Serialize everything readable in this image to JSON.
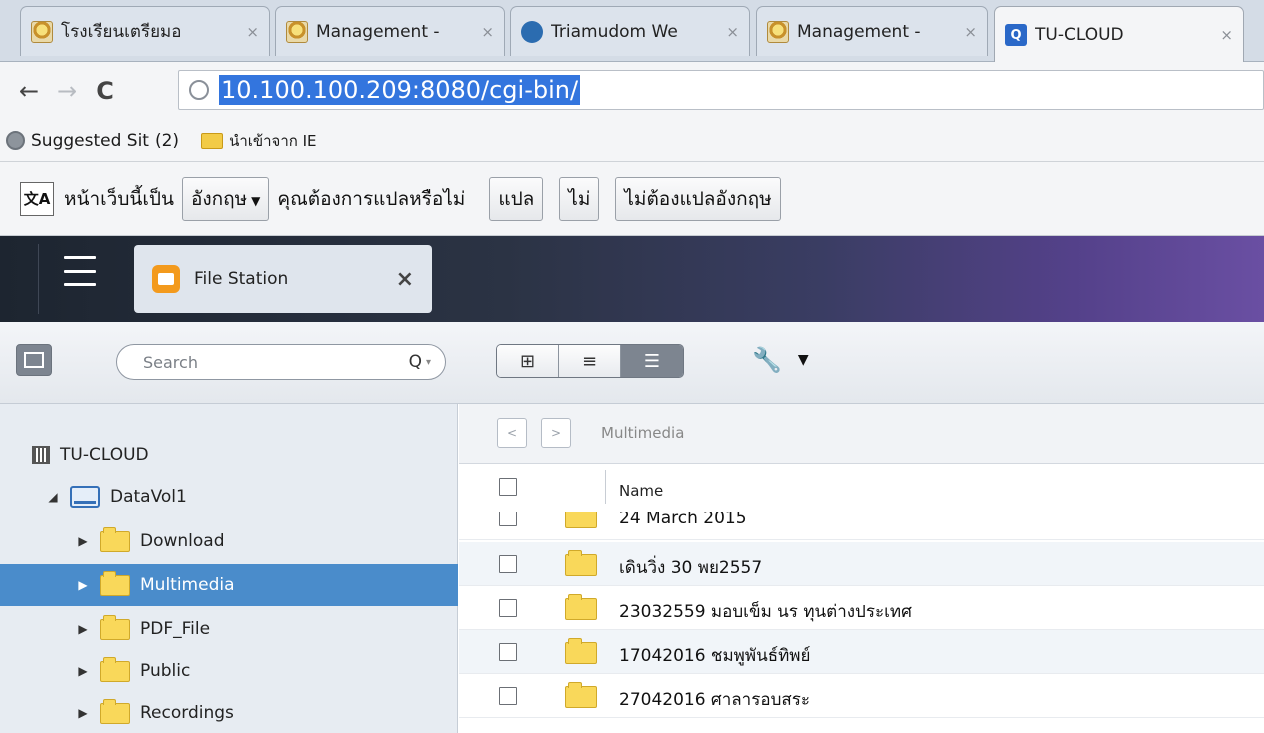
{
  "browser": {
    "tabs": [
      {
        "title": "โรงเรียนเตรียมอ",
        "favicon": "crest-icon",
        "active": false
      },
      {
        "title": "Management -",
        "favicon": "crest-icon",
        "active": false
      },
      {
        "title": "Triamudom We",
        "favicon": "globe-icon",
        "active": false
      },
      {
        "title": "Management -",
        "favicon": "crest-icon",
        "active": false
      },
      {
        "title": "TU-CLOUD",
        "favicon": "cloud-icon",
        "active": true
      }
    ],
    "tab_close": "×",
    "back": "←",
    "forward": "→",
    "reload": "C",
    "url": "10.100.100.209:8080/cgi-bin/",
    "bookmarks": [
      {
        "label": "Suggested Sit",
        "icon": "globe-icon"
      },
      {
        "label": "(2)",
        "icon": ""
      },
      {
        "label": "นำเข้าจาก IE",
        "icon": "folder-icon"
      }
    ]
  },
  "translate_bar": {
    "icon_label": "文A",
    "prefix": "หน้าเว็บนี้เป็น",
    "language": "อังกฤษ",
    "question": "คุณต้องการแปลหรือไม่",
    "translate_btn": "แปล",
    "no_btn": "ไม่",
    "never_btn": "ไม่ต้องแปลอังกฤษ"
  },
  "app": {
    "tab_name": "File Station",
    "close": "×"
  },
  "toolbar": {
    "search_placeholder": "Search",
    "search_icon": "Q",
    "search_dropdown": "▾",
    "view_icons": [
      "⊞",
      "≡",
      "☰"
    ],
    "active_view": 2,
    "tools_icon": "🔧",
    "tools_dropdown": "▼"
  },
  "tree": {
    "root": "TU-CLOUD",
    "volume": "DataVol1",
    "folders": [
      "Download",
      "Multimedia",
      "PDF_File",
      "Public",
      "Recordings"
    ],
    "selected": "Multimedia"
  },
  "filelist": {
    "prev": "<",
    "next": ">",
    "path": "Multimedia",
    "column_name": "Name",
    "rows": [
      "24 March 2015",
      "เดินวิ่ง 30 พย2557",
      "23032559 มอบเข็ม นร ทุนต่างประเทศ",
      "17042016 ชมพูพันธ์ทิพย์",
      "27042016 ศาลารอบสระ"
    ]
  }
}
